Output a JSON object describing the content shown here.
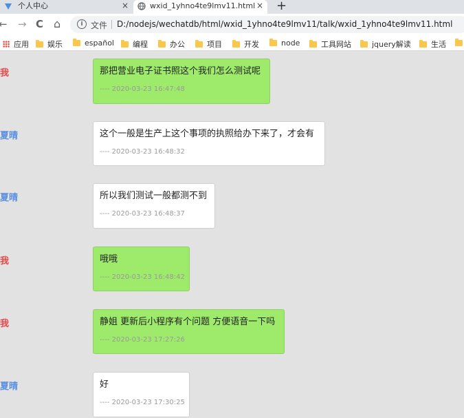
{
  "browser": {
    "tabs": [
      {
        "title": "个人中心",
        "close": "×"
      },
      {
        "title": "wxid_1yhno4te9lmv11.html",
        "close": "×"
      }
    ],
    "new_tab": "+",
    "nav": {
      "back": "←",
      "forward": "→",
      "reload": "C",
      "home": "⌂"
    },
    "address": {
      "info": "i",
      "scheme_label": "文件",
      "url": "D:/nodejs/wechatdb/html/wxid_1yhno4te9lmv11/talk/wxid_1yhno4te9lmv11.html"
    },
    "bookmarks": [
      "应用",
      "娱乐",
      "español",
      "编程",
      "办公",
      "项目",
      "开发",
      "node",
      "工具网站",
      "jquery解读",
      "生活"
    ]
  },
  "colors": {
    "sender_self": "#e8484a",
    "sender_other": "#5a8fe0",
    "bubble_green": "#9eea6a",
    "bubble_white": "#ffffff",
    "background": "#e2e2e2"
  },
  "messages": [
    {
      "sender": "我",
      "side": "self",
      "text": "那把营业电子证书照这个我们怎么测试呢",
      "time": "---- 2020-03-23 16:47:48"
    },
    {
      "sender": "夏晴",
      "side": "other",
      "text": "这个一般是生产上这个事项的执照给办下来了，才会有",
      "time": "---- 2020-03-23 16:48:32"
    },
    {
      "sender": "夏晴",
      "side": "other",
      "text": "所以我们测试一般都测不到",
      "time": "---- 2020-03-23 16:48:37"
    },
    {
      "sender": "我",
      "side": "self",
      "text": "哦哦",
      "time": "---- 2020-03-23 16:48:42"
    },
    {
      "sender": "我",
      "side": "self",
      "text": "静姐 更新后小程序有个问题 方便语音一下吗",
      "time": "---- 2020-03-23 17:27:26"
    },
    {
      "sender": "夏晴",
      "side": "other",
      "text": "好",
      "time": "---- 2020-03-23 17:30:25"
    }
  ]
}
